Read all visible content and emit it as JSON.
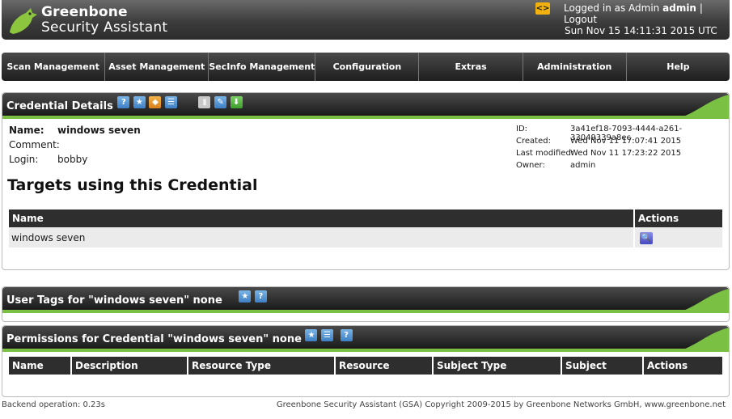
{
  "header": {
    "brand_line1": "Greenbone",
    "brand_line2": "Security Assistant",
    "language_button": "<>",
    "logged_in_prefix": "Logged in as Admin",
    "username": "admin",
    "separator": "|",
    "logout": "Logout",
    "datetime": "Sun Nov 15 14:11:31 2015 UTC"
  },
  "nav": [
    "Scan Management",
    "Asset Management",
    "SecInfo Management",
    "Configuration",
    "Extras",
    "Administration",
    "Help"
  ],
  "credential": {
    "title": "Credential Details",
    "name_label": "Name:",
    "name_value": "windows seven",
    "comment_label": "Comment:",
    "comment_value": "",
    "login_label": "Login:",
    "login_value": "bobby",
    "id_label": "ID:",
    "id_value": "3a41ef18-7093-4444-a261-33049339a8ec",
    "created_label": "Created:",
    "created_value": "Wed Nov 11 17:07:41 2015",
    "modified_label": "Last modified:",
    "modified_value": "Wed Nov 11 17:23:22 2015",
    "owner_label": "Owner:",
    "owner_value": "admin"
  },
  "targets": {
    "heading": "Targets using this Credential",
    "columns": [
      "Name",
      "Actions"
    ],
    "rows": [
      {
        "name": "windows seven"
      }
    ]
  },
  "user_tags": {
    "title": "User Tags for \"windows seven\" none"
  },
  "permissions": {
    "title": "Permissions for Credential \"windows seven\" none",
    "columns": [
      "Name",
      "Description",
      "Resource Type",
      "Resource",
      "Subject Type",
      "Subject",
      "Actions"
    ]
  },
  "footer": {
    "backend": "Backend operation: 0.23s",
    "copyright": "Greenbone Security Assistant (GSA) Copyright 2009-2015 by Greenbone Networks GmbH, www.greenbone.net"
  },
  "colors": {
    "accent_green": "#7ac043",
    "header_dark": "#2c2c2c",
    "icon_blue": "#3e7fc4"
  }
}
